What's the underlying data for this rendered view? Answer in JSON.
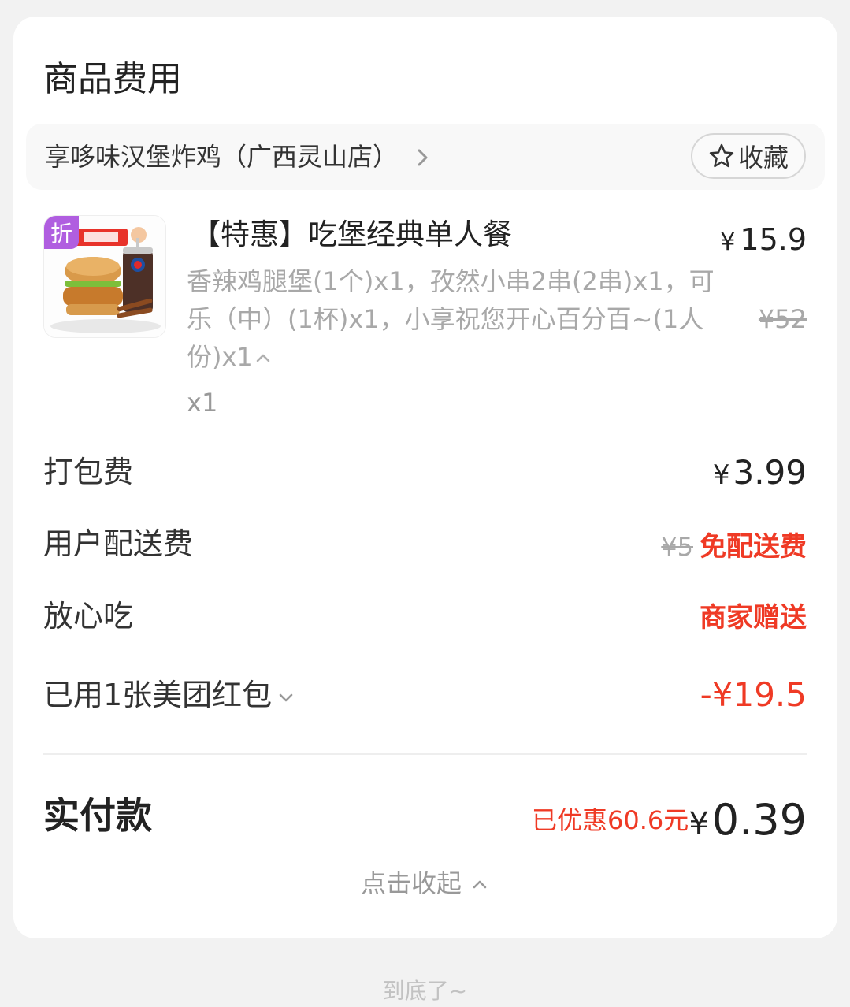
{
  "section": {
    "title": "商品费用"
  },
  "store": {
    "name": "享哆味汉堡炸鸡（广西灵山店）",
    "favorite_label": "收藏"
  },
  "item": {
    "discount_tag": "折",
    "title": "【特惠】吃堡经典单人餐",
    "description": "香辣鸡腿堡(1个)x1，孜然小串2串(2串)x1，可乐（中）(1杯)x1，小享祝您开心百分百~(1人份)x1",
    "quantity": "x1",
    "currency": "¥",
    "price": "15.9",
    "original_price": "¥52"
  },
  "fees": {
    "packing": {
      "label": "打包费",
      "currency": "¥",
      "value": "3.99"
    },
    "delivery": {
      "label": "用户配送费",
      "original": "¥5",
      "value": "免配送费"
    },
    "assurance": {
      "label": "放心吃",
      "value": "商家赠送"
    },
    "coupon": {
      "label": "已用1张美团红包",
      "value": "-¥19.5"
    }
  },
  "total": {
    "label": "实付款",
    "saved": "已优惠60.6元",
    "currency": "¥",
    "amount": "0.39"
  },
  "collapse_label": "点击收起",
  "footer_note": "到底了~",
  "colors": {
    "accent_red": "#ef3a25",
    "discount_purple": "#b05ee0",
    "card_bg": "#ffffff",
    "page_bg": "#f2f2f2"
  }
}
